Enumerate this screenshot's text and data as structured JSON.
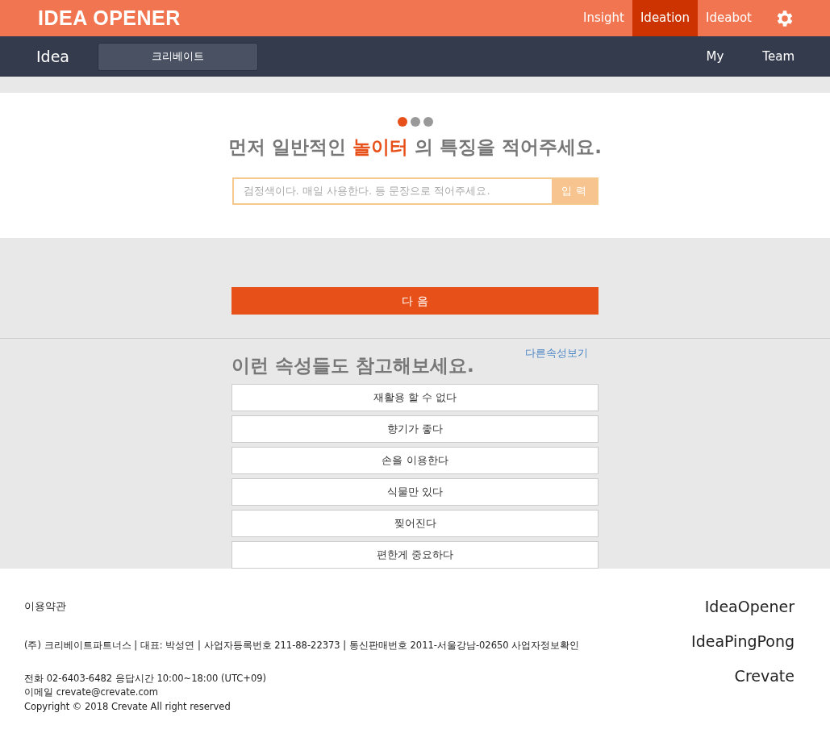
{
  "topbar": {
    "logo": "IDEA OPENER",
    "nav": [
      {
        "label": "Insight",
        "selected": false
      },
      {
        "label": "Ideation",
        "selected": true
      },
      {
        "label": "Ideabot",
        "selected": false
      }
    ]
  },
  "subbar": {
    "title": "Idea",
    "button": "크리베이트",
    "links": [
      "My",
      "Team"
    ]
  },
  "steps": [
    {
      "selected": true
    },
    {
      "selected": false
    },
    {
      "selected": false
    }
  ],
  "question": "먼저 일반적인 **놀이터** 의 특징을 적어주세요.",
  "input": {
    "placeholder": "검정색이다. 매일 사용한다. 등 문장으로 적어주세요.",
    "button": "입 력"
  },
  "next_button": "다 음",
  "suggestions": {
    "title": "이런 속성들도 참고해보세요.",
    "more_link": "다른속성보기",
    "items": [
      "재활용 할 수 없다",
      "향기가 좋다",
      "손을 이용한다",
      "식물만 있다",
      "찢어진다",
      "편한게 중요하다"
    ]
  },
  "footer": {
    "terms": "이용약관",
    "company": "(주) 크리베이트파트너스 | 대표: 박성연 | 사업자등록번호 211-88-22373 | 통신판매번호 2011-서울강남-02650 사업자정보확인",
    "contact": [
      "전화 02-6403-6482 응답시간 10:00~18:00 (UTC+09)",
      "이메일 crevate@crevate.com",
      "Copyright © 2018 Crevate All right reserved"
    ],
    "links": [
      "IdeaOpener",
      "IdeaPingPong",
      "Crevate"
    ]
  }
}
